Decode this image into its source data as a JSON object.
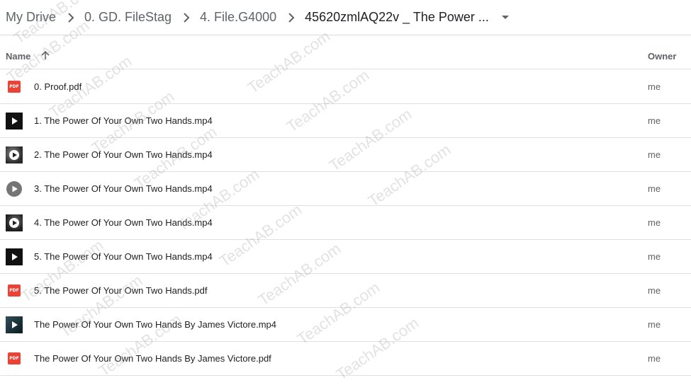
{
  "breadcrumb": {
    "items": [
      "My Drive",
      "0. GD. FileStag",
      "4. File.G4000",
      "45620zmlAQ22v _ The Power ..."
    ]
  },
  "columns": {
    "name": "Name",
    "owner": "Owner"
  },
  "files": [
    {
      "name": "0. Proof.pdf",
      "owner": "me",
      "type": "pdf-icon"
    },
    {
      "name": "1. The Power Of Your Own Two Hands.mp4",
      "owner": "me",
      "type": "video-icon"
    },
    {
      "name": "2. The Power Of Your Own Two Hands.mp4",
      "owner": "me",
      "type": "video-icon"
    },
    {
      "name": "3. The Power Of Your Own Two Hands.mp4",
      "owner": "me",
      "type": "video-icon"
    },
    {
      "name": "4. The Power Of Your Own Two Hands.mp4",
      "owner": "me",
      "type": "video-icon"
    },
    {
      "name": "5. The Power Of Your Own Two Hands.mp4",
      "owner": "me",
      "type": "video-icon"
    },
    {
      "name": "5. The Power Of Your Own Two Hands.pdf",
      "owner": "me",
      "type": "pdf-icon"
    },
    {
      "name": "The Power Of Your Own Two Hands By James Victore.mp4",
      "owner": "me",
      "type": "video-icon"
    },
    {
      "name": "The Power Of Your Own Two Hands By James Victore.pdf",
      "owner": "me",
      "type": "pdf-icon"
    }
  ],
  "pdf_icon_label": "PDF",
  "watermark_text": "TeachAB.com",
  "colors": {
    "pdf": "#ea4335",
    "text": "#202124",
    "muted": "#5f6368",
    "divider": "#e0e0e0"
  }
}
